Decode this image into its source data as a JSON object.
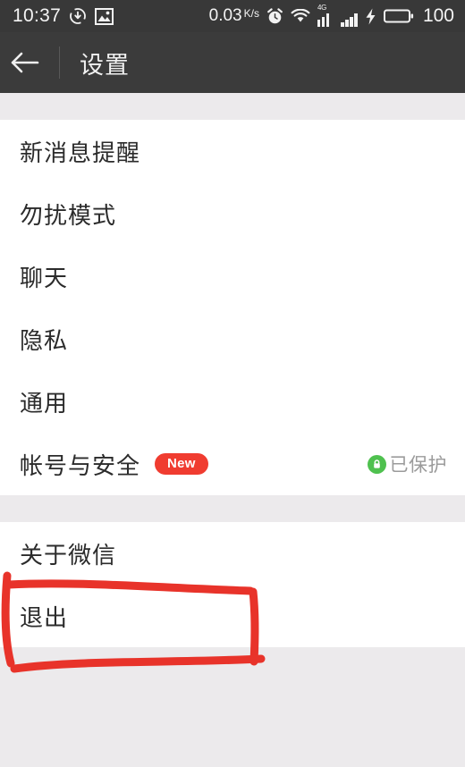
{
  "status_bar": {
    "clock": "10:37",
    "icons_left": [
      "sync-icon",
      "gallery-icon"
    ],
    "net_speed_value": "0.03",
    "net_speed_unit": "K/s",
    "net_speed_unit_num": "K",
    "net_speed_unit_den": "s",
    "icons_right": [
      "alarm-icon",
      "wifi-icon",
      "signal-4g-icon",
      "signal-icon",
      "charging-bolt-icon",
      "battery-icon"
    ],
    "network_label": "4G",
    "battery_level": "100"
  },
  "title_bar": {
    "back_icon": "back-arrow-icon",
    "title": "设置"
  },
  "settings": {
    "group_1": [
      {
        "label": "新消息提醒"
      },
      {
        "label": "勿扰模式"
      },
      {
        "label": "聊天"
      },
      {
        "label": "隐私"
      },
      {
        "label": "通用"
      },
      {
        "label": "帐号与安全",
        "badge": "New",
        "badge_color": "#f03c30",
        "status_text": "已保护",
        "status_icon": "lock-icon",
        "status_icon_color": "#4fc14f"
      }
    ],
    "group_2": [
      {
        "label": "关于微信"
      },
      {
        "label": "退出"
      }
    ]
  },
  "annotation": {
    "type": "hand-drawn-rectangle",
    "color": "#e8332a",
    "target": "退出"
  }
}
